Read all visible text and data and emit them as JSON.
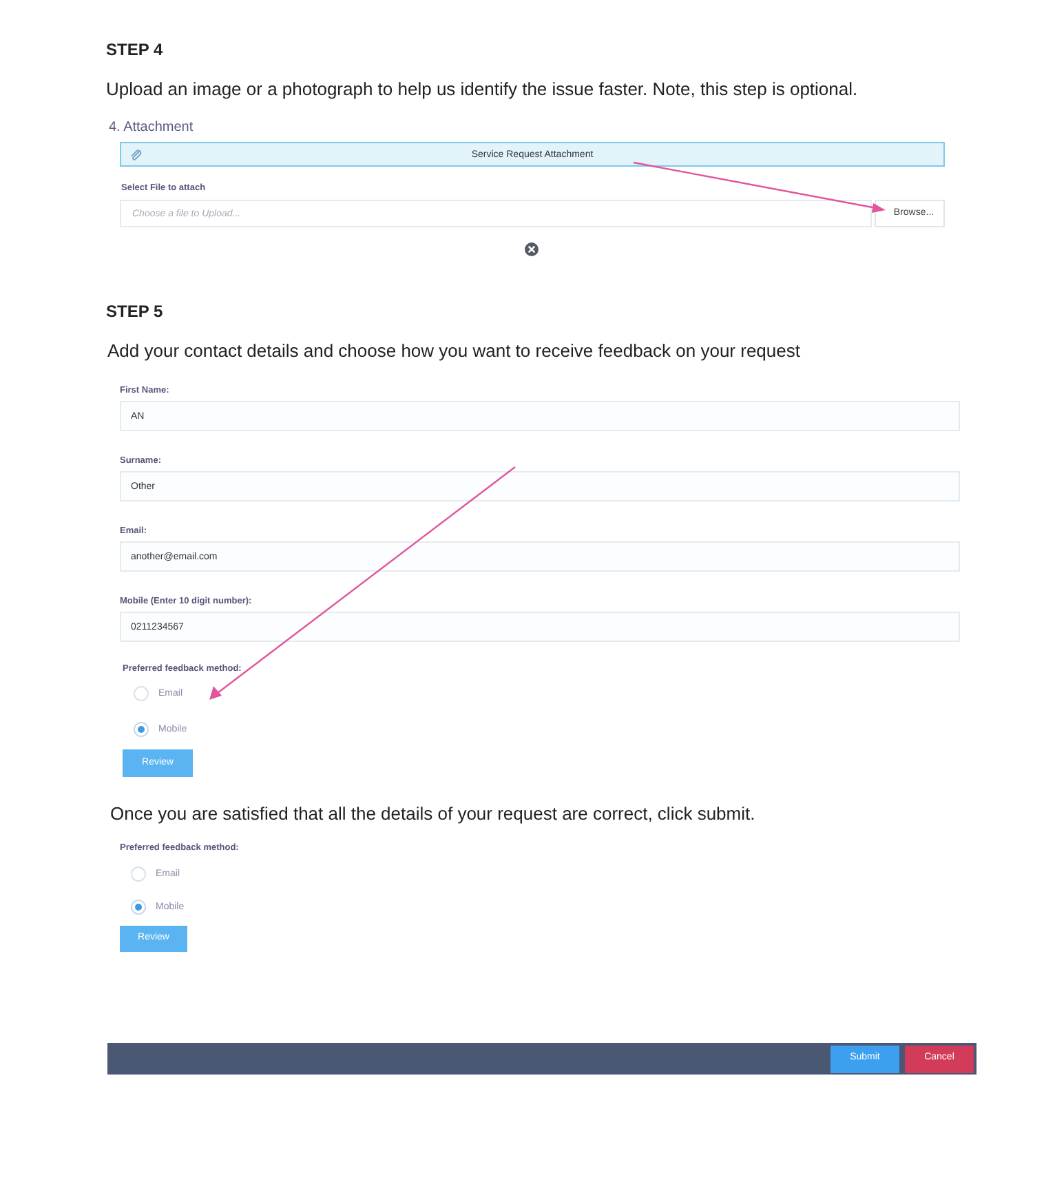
{
  "step4": {
    "heading": "STEP 4",
    "instructions": "Upload an image or a photograph to help us identify the issue faster. Note, this step is optional.",
    "section_label": "4. Attachment",
    "panel_title": "Service Request Attachment",
    "file_field": {
      "label": "Select File to attach",
      "placeholder": "Choose a file to Upload...",
      "button": "Browse..."
    }
  },
  "step5": {
    "heading": "STEP 5",
    "instructions": "Add your contact details and choose how you want to receive feedback on your request",
    "fields": [
      {
        "label": "First Name:",
        "value": "AN"
      },
      {
        "label": "Surname:",
        "value": "Other"
      },
      {
        "label": "Email:",
        "value": "another@email.com"
      },
      {
        "label": "Mobile (Enter 10 digit number):",
        "value": "0211234567"
      }
    ],
    "feedback": {
      "label": "Preferred feedback method:",
      "options": [
        {
          "label": "Email",
          "selected": false
        },
        {
          "label": "Mobile",
          "selected": true
        }
      ]
    },
    "review_button": "Review"
  },
  "review_section": {
    "instructions": "Once you are satisfied that all the details of your request are correct, click submit.",
    "feedback": {
      "label": "Preferred feedback method:",
      "options": [
        {
          "label": "Email",
          "selected": false
        },
        {
          "label": "Mobile",
          "selected": true
        }
      ]
    },
    "review_button": "Review"
  },
  "footer": {
    "buttons": [
      {
        "label": "Submit",
        "kind": "primary"
      },
      {
        "label": "Cancel",
        "kind": "danger"
      }
    ]
  }
}
